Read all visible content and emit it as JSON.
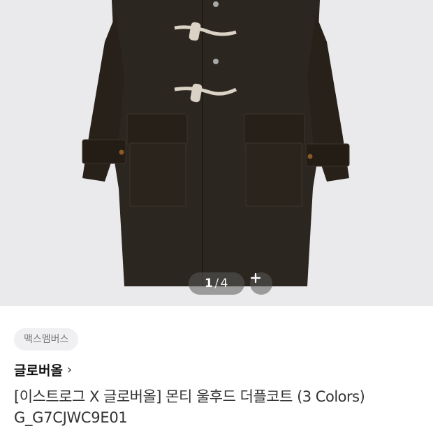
{
  "product_image": {
    "alt_icon": "coat-image"
  },
  "pager": {
    "current": "1",
    "separator": "/",
    "total": "4"
  },
  "zoom": {
    "icon": "plus-icon"
  },
  "category_tag": "맥스멤버스",
  "brand": {
    "name": "글로버올",
    "chevron": "›"
  },
  "product": {
    "title": "[이스트로그 X 글로버올] 몬티 울후드 더플코트 (3 Colors)",
    "code": "G_G7CJWC9E01"
  },
  "colors": {
    "background": "#eaeaec",
    "coat": "#2c2620",
    "toggle": "#d9d2c5"
  }
}
